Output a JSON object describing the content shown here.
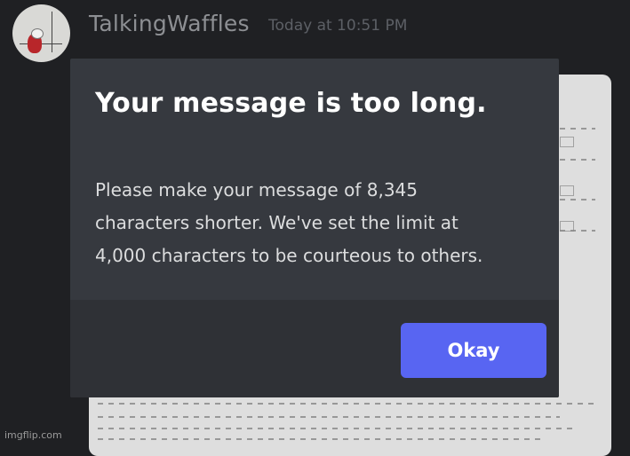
{
  "message": {
    "username": "TalkingWaffles",
    "timestamp": "Today at 10:51 PM"
  },
  "modal": {
    "title": "Your message is too long.",
    "body_line_1": "Please make your message of 8,345",
    "body_line_2": "characters shorter. We've set the limit at",
    "body_line_3": "4,000 characters to be courteous to others.",
    "button_label": "Okay"
  },
  "watermark": "imgflip.com",
  "colors": {
    "background": "#1f2023",
    "modal": "#36393f",
    "footer": "#2f3136",
    "button": "#5865f2"
  }
}
